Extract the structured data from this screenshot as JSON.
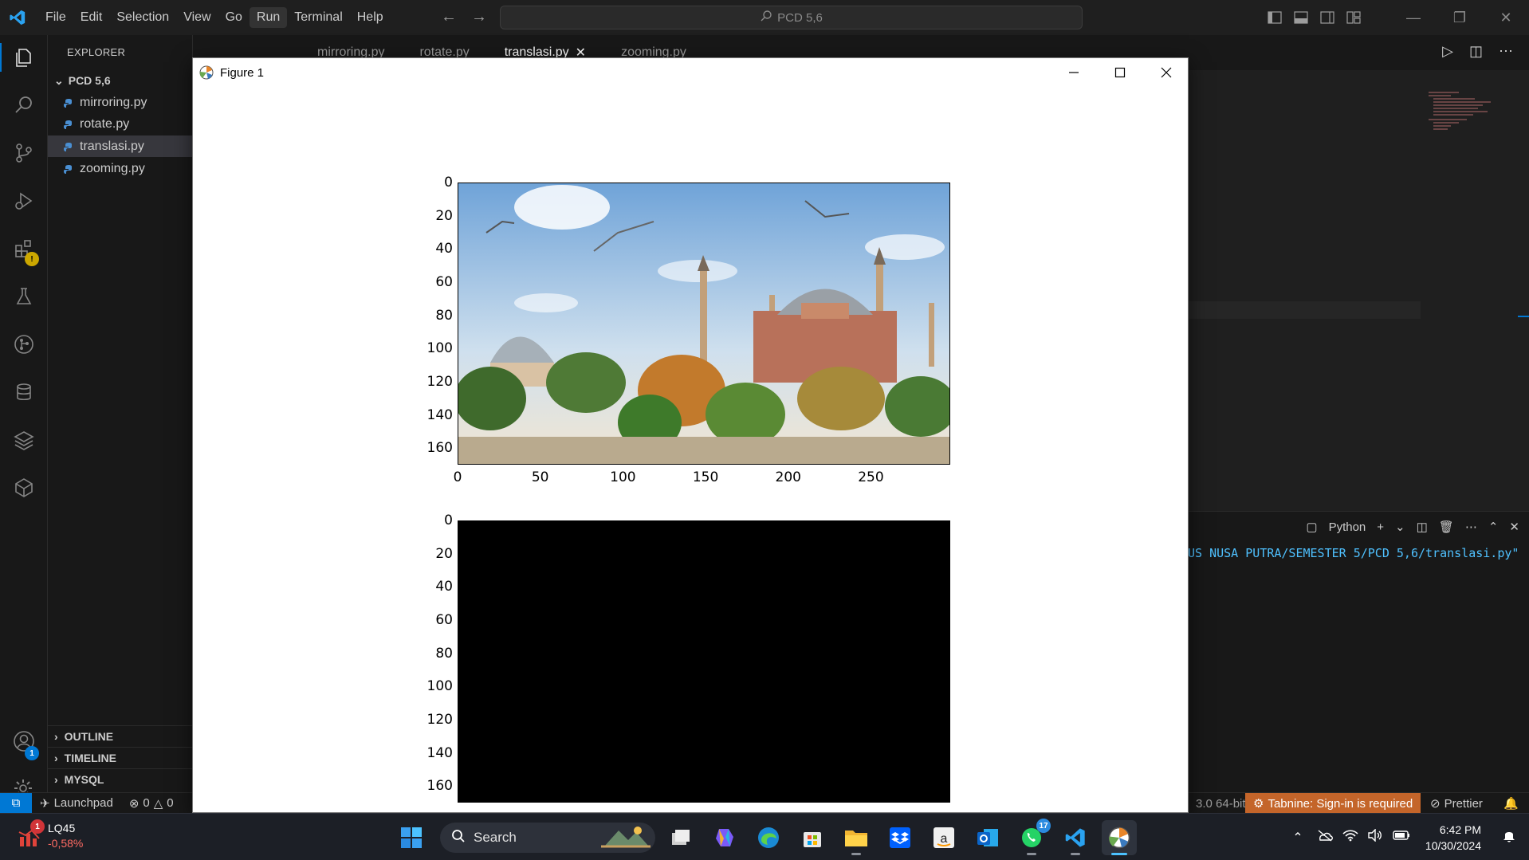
{
  "titlebar": {
    "menu": [
      "File",
      "Edit",
      "Selection",
      "View",
      "Go",
      "Run",
      "Terminal",
      "Help"
    ],
    "active_menu": "Run",
    "search_text": "PCD 5,6"
  },
  "sidebar": {
    "title": "EXPLORER",
    "more": "···",
    "folder": "PCD 5,6",
    "files": [
      "mirroring.py",
      "rotate.py",
      "translasi.py",
      "zooming.py"
    ],
    "selected_file": "translasi.py",
    "sections": [
      "OUTLINE",
      "TIMELINE",
      "MYSQL"
    ]
  },
  "activity": {
    "accounts_badge": "1"
  },
  "tabs": [
    "mirroring.py",
    "rotate.py",
    "translasi.py",
    "zooming.py"
  ],
  "active_tab": "translasi.py",
  "panel": {
    "shell": "Python",
    "terminal_line": "US NUSA PUTRA/SEMESTER 5/PCD 5,6/translasi.py\""
  },
  "statusbar": {
    "launchpad": "Launchpad",
    "errors": "0",
    "warnings": "0",
    "python_ver": "3.0 64-bit",
    "tabnine": "Tabnine: Sign-in is required",
    "prettier": "Prettier"
  },
  "figure": {
    "title": "Figure 1",
    "plot1": {
      "yticks": [
        "0",
        "20",
        "40",
        "60",
        "80",
        "100",
        "120",
        "140",
        "160"
      ],
      "xticks": [
        "0",
        "50",
        "100",
        "150",
        "200",
        "250"
      ]
    },
    "plot2": {
      "yticks": [
        "0",
        "20",
        "40",
        "60",
        "80",
        "100",
        "120",
        "140",
        "160"
      ]
    }
  },
  "taskbar": {
    "stock_name": "LQ45",
    "stock_change": "-0,58%",
    "stock_badge": "1",
    "search": "Search",
    "whatsapp_badge": "17",
    "time": "6:42 PM",
    "date": "10/30/2024"
  },
  "colors": {
    "accent": "#0078d4",
    "tabnine": "#c4652a",
    "terminal_text": "#4fc1ff"
  }
}
